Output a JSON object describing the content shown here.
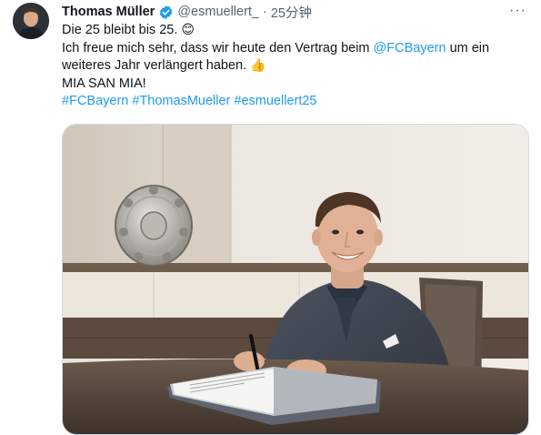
{
  "tweet": {
    "author_name": "Thomas Müller",
    "handle": "@esmuellert_",
    "separator": "·",
    "time": "25分钟",
    "lines": {
      "l1": "Die 25 bleibt bis 25.",
      "l1_emoji": "😊",
      "l2_before": "Ich freue mich sehr, dass wir heute den Vertrag beim ",
      "l2_mention": "@FCBayern",
      "l2_after": " um ein",
      "l3": "weiteres Jahr verlängert haben. ",
      "l3_emoji": "👍",
      "l4": "MIA SAN MIA!"
    },
    "hashtags": [
      "#FCBayern",
      "#ThomasMueller",
      "#esmuellert25"
    ],
    "more_label": "···"
  },
  "icons": {
    "verified": "verified-badge-icon",
    "more": "more-options-icon"
  },
  "colors": {
    "link": "#1d9bf0",
    "secondary_text": "#536471",
    "border": "#cfd9de"
  }
}
